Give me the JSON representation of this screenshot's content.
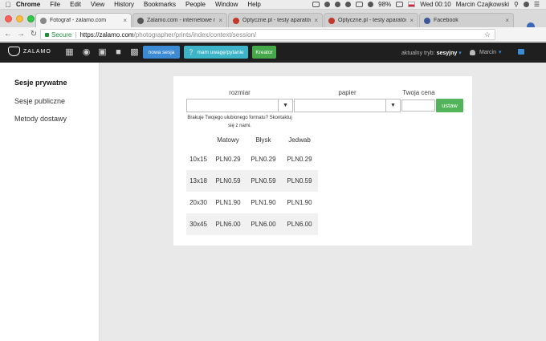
{
  "menubar": {
    "items": [
      "Chrome",
      "File",
      "Edit",
      "View",
      "History",
      "Bookmarks",
      "People",
      "Window",
      "Help"
    ],
    "battery": "98%",
    "time": "Wed 00:10",
    "user": "Marcin Czajkowski"
  },
  "tabs": [
    {
      "title": "Fotograf - zalamo.com",
      "fav_color": "#888888"
    },
    {
      "title": "Zalamo.com - internetowe nał",
      "fav_color": "#555555"
    },
    {
      "title": "Optyczne.pl - testy aparatów",
      "fav_color": "#c0392b"
    },
    {
      "title": "Optyczne.pl - testy aparatów",
      "fav_color": "#c0392b"
    },
    {
      "title": "Facebook",
      "fav_color": "#3b5998"
    }
  ],
  "address": {
    "secure_label": "Secure",
    "url_host": "https://zalamo.com",
    "url_path": "/photographer/prints/index/context/session/"
  },
  "header": {
    "logo_text": "ZALAMO",
    "btn_new_session": "nowa sesja",
    "btn_feedback": "mam uwagę/pytanie",
    "btn_creator": "Kreator",
    "mode_label": "aktualny tryb:",
    "mode_value": "sesyjny",
    "user_name": "Marcin"
  },
  "sidebar": {
    "items": [
      {
        "label": "Sesje prywatne"
      },
      {
        "label": "Sesje publiczne"
      },
      {
        "label": "Metody dostawy"
      }
    ]
  },
  "form": {
    "size_label": "rozmiar",
    "paper_label": "papier",
    "price_label": "Twoja cena",
    "set_button": "ustaw",
    "missing_note_1": "Brakuje Twojego ulubionego formatu? Skontaktuj",
    "missing_note_2": "się z nami."
  },
  "table": {
    "headers": [
      "",
      "Matowy",
      "Błysk",
      "Jedwab"
    ],
    "rows": [
      [
        "10x15",
        "PLN0.29",
        "PLN0.29",
        "PLN0.29"
      ],
      [
        "13x18",
        "PLN0.59",
        "PLN0.59",
        "PLN0.59"
      ],
      [
        "20x30",
        "PLN1.90",
        "PLN1.90",
        "PLN1.90"
      ],
      [
        "30x45",
        "PLN6.00",
        "PLN6.00",
        "PLN6.00"
      ]
    ]
  },
  "colors": {
    "header_bg": "#1f1f1f",
    "btn_blue": "#3d8ad5",
    "btn_teal": "#3eb4c8",
    "btn_green": "#47a84b",
    "ustaw_green": "#52b45a"
  }
}
